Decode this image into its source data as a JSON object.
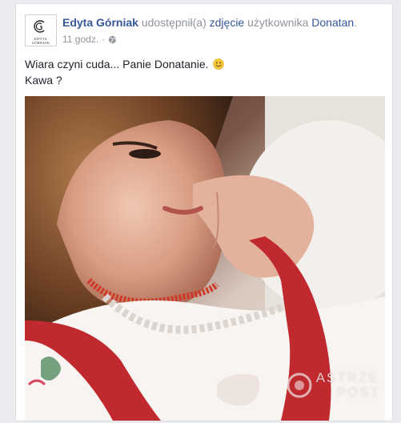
{
  "post": {
    "avatar_text": "EDYTA GÓRNIAK",
    "author": "Edyta Górniak",
    "action": "udostępnił(a)",
    "object_link": "zdjęcie",
    "middle": "użytkownika",
    "owner": "Donatan",
    "owner_suffix": ".",
    "time": "11 godz.",
    "separator": "·",
    "privacy_icon": "globe-icon",
    "text_line1": "Wiara czyni cuda... Panie Donatanie.",
    "text_emoji": "smiley-emoji",
    "text_line2": "Kawa ?"
  },
  "watermark": {
    "line1": "ASTRZE",
    "line2": "POST"
  },
  "colors": {
    "link": "#365899",
    "meta": "#90949c",
    "text": "#1d2129",
    "background": "#e9ebee"
  }
}
